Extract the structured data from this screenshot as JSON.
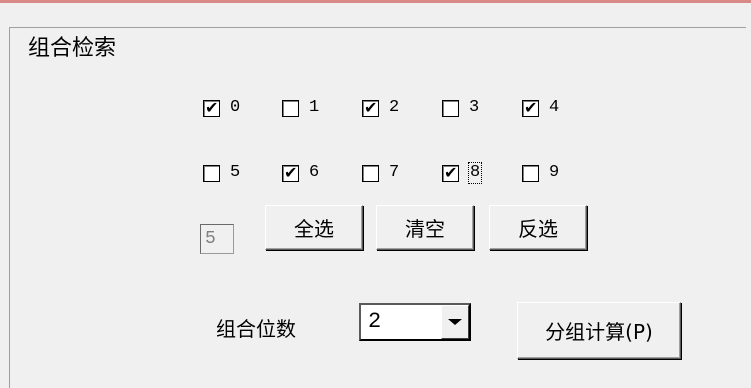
{
  "groupbox": {
    "title": "组合检索"
  },
  "digits": [
    {
      "label": "0",
      "checked": true
    },
    {
      "label": "1",
      "checked": false
    },
    {
      "label": "2",
      "checked": true
    },
    {
      "label": "3",
      "checked": false
    },
    {
      "label": "4",
      "checked": true
    },
    {
      "label": "5",
      "checked": false
    },
    {
      "label": "6",
      "checked": true
    },
    {
      "label": "7",
      "checked": false
    },
    {
      "label": "8",
      "checked": true
    },
    {
      "label": "9",
      "checked": false
    }
  ],
  "selected_count": "5",
  "buttons": {
    "select_all": "全选",
    "clear": "清空",
    "invert": "反选",
    "group_calc": "分组计算(P)"
  },
  "combo": {
    "label": "组合位数",
    "value": "2"
  },
  "colors": {
    "window_bg": "#f0f0f0",
    "top_line": "#d98a86"
  }
}
